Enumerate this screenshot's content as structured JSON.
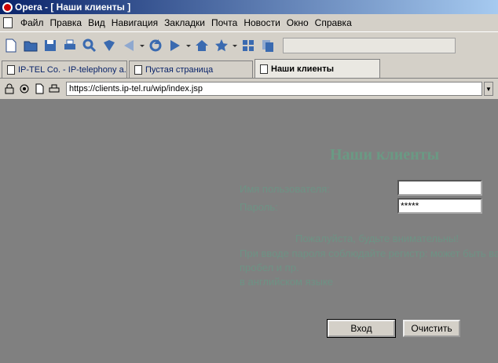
{
  "window": {
    "title": "Opera - [ Наши клиенты ]"
  },
  "menu": [
    "Файл",
    "Правка",
    "Вид",
    "Навигация",
    "Закладки",
    "Почта",
    "Новости",
    "Окно",
    "Справка"
  ],
  "toolbar": {
    "icons": [
      "new-page-icon",
      "open-folder-icon",
      "save-icon",
      "print-icon",
      "find-icon",
      "hotlist-icon",
      "back-icon",
      "reload-icon",
      "forward-icon",
      "home-icon",
      "bookmark-star-icon",
      "tile-icon",
      "cascade-icon"
    ]
  },
  "tabs": [
    {
      "label": "IP-TEL Co. - IP-telephony a..."
    },
    {
      "label": "Пустая страница"
    },
    {
      "label": "Наши клиенты"
    }
  ],
  "address": {
    "url": "https://clients.ip-tel.ru/wip/index.jsp"
  },
  "page": {
    "heading": "Наши клиенты",
    "login_label": "Имя пользователя:",
    "password_label": "Пароль:",
    "login_value": "",
    "password_value": "*****",
    "messages": [
      "Пожалуйста, будьте внимательны!",
      "При вводе пароля соблюдайте регистр: может быть важен",
      "пробел и пр.",
      "в английском языке"
    ],
    "login_button": "Вход",
    "clear_button": "Очистить"
  },
  "colors": {
    "titlebar": "#0a246a",
    "chrome": "#d4d0c8",
    "content_bg": "#808080",
    "faint_text": "#6d9284"
  }
}
